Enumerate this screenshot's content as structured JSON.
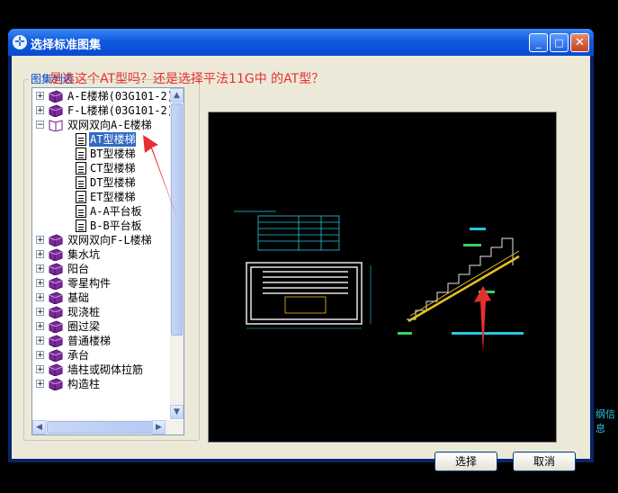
{
  "window": {
    "title": "选择标准图集"
  },
  "title_buttons": {
    "minimize": "_",
    "maximize": "□",
    "close": "✕"
  },
  "group": {
    "label": "图集列表"
  },
  "annotation": "是选这个AT型吗？还是选择平法11G中 的AT型？",
  "tree": [
    {
      "label": "A-E楼梯(03G101-2)",
      "level": 0,
      "type": "book",
      "expander": "+"
    },
    {
      "label": "F-L楼梯(03G101-2)",
      "level": 0,
      "type": "book",
      "expander": "+"
    },
    {
      "label": "双网双向A-E楼梯",
      "level": 0,
      "type": "book-open",
      "expander": "−"
    },
    {
      "label": "AT型楼梯",
      "level": 1,
      "type": "doc",
      "selected": true
    },
    {
      "label": "BT型楼梯",
      "level": 1,
      "type": "doc"
    },
    {
      "label": "CT型楼梯",
      "level": 1,
      "type": "doc"
    },
    {
      "label": "DT型楼梯",
      "level": 1,
      "type": "doc"
    },
    {
      "label": "ET型楼梯",
      "level": 1,
      "type": "doc"
    },
    {
      "label": "A-A平台板",
      "level": 1,
      "type": "doc"
    },
    {
      "label": "B-B平台板",
      "level": 1,
      "type": "doc"
    },
    {
      "label": "双网双向F-L楼梯",
      "level": 0,
      "type": "book",
      "expander": "+"
    },
    {
      "label": "集水坑",
      "level": 0,
      "type": "book",
      "expander": "+"
    },
    {
      "label": "阳台",
      "level": 0,
      "type": "book",
      "expander": "+"
    },
    {
      "label": "零星构件",
      "level": 0,
      "type": "book",
      "expander": "+"
    },
    {
      "label": "基础",
      "level": 0,
      "type": "book",
      "expander": "+"
    },
    {
      "label": "现浇桩",
      "level": 0,
      "type": "book",
      "expander": "+"
    },
    {
      "label": "圈过梁",
      "level": 0,
      "type": "book",
      "expander": "+"
    },
    {
      "label": "普通楼梯",
      "level": 0,
      "type": "book",
      "expander": "+"
    },
    {
      "label": "承台",
      "level": 0,
      "type": "book",
      "expander": "+"
    },
    {
      "label": "墙柱或砌体拉筋",
      "level": 0,
      "type": "book",
      "expander": "+"
    },
    {
      "label": "构造柱",
      "level": 0,
      "type": "book",
      "expander": "+"
    }
  ],
  "scroll": {
    "up": "▲",
    "down": "▼",
    "left": "◀",
    "right": "▶"
  },
  "buttons": {
    "select": "选择",
    "cancel": "取消"
  },
  "background": {
    "right_edge_text": "纲信息"
  },
  "colors": {
    "titlebar": "#0a4ad0",
    "selection": "#316ac5",
    "annotation_red": "#e53030",
    "cad_cyan": "#27c7e0",
    "cad_yellow": "#e8c020"
  }
}
